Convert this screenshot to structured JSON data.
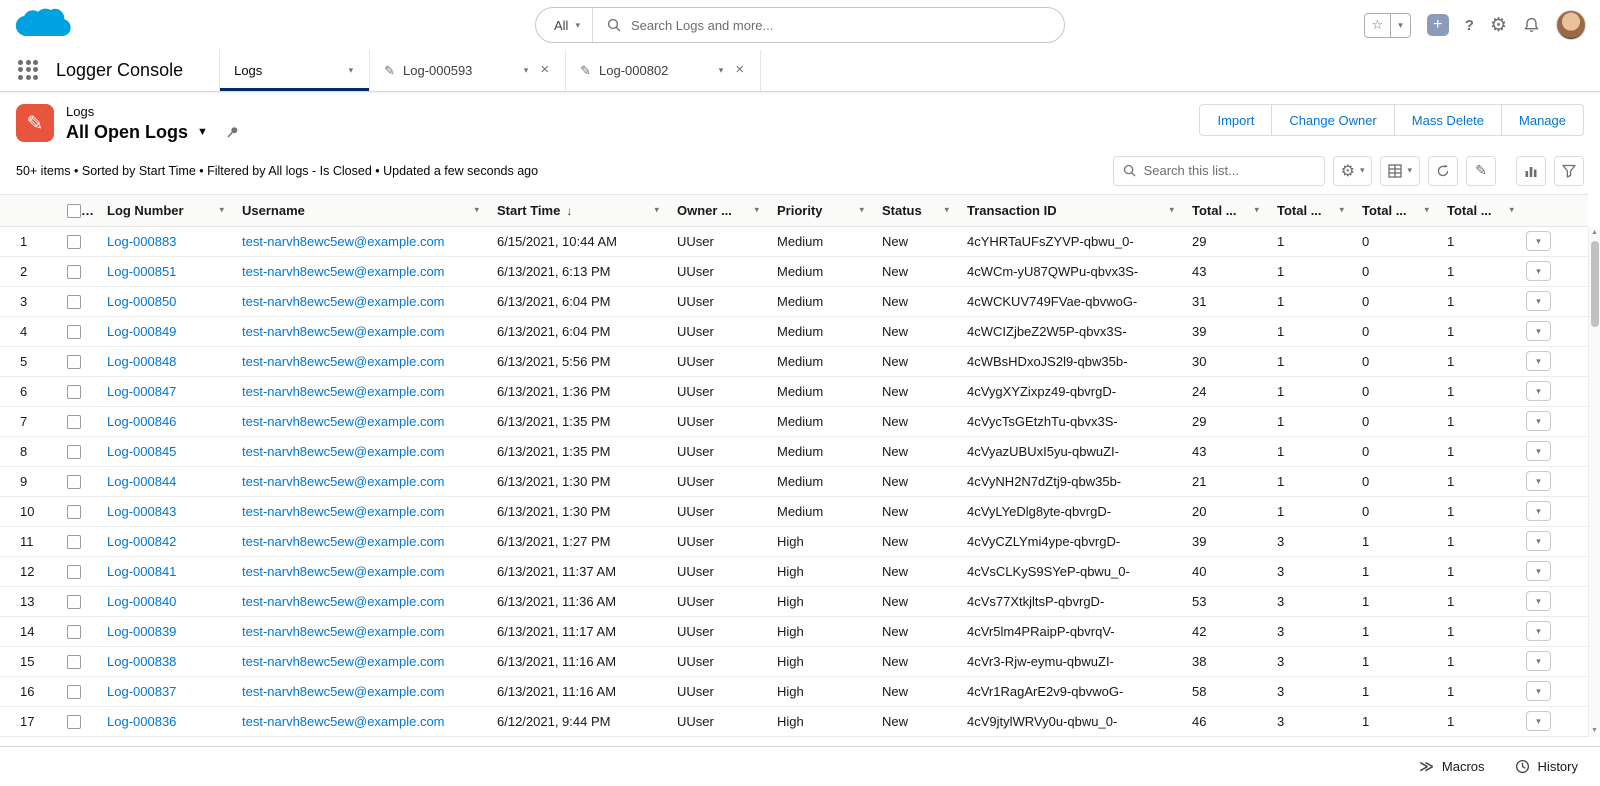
{
  "colors": {
    "brand_cloud": "#00a1e0",
    "link": "#0176d3",
    "active_tab_underline": "#032d60",
    "record_icon_bg": "#e8553d"
  },
  "global_header": {
    "search_scope": "All",
    "search_placeholder": "Search Logs and more..."
  },
  "nav": {
    "app_name": "Logger Console",
    "tabs": [
      {
        "label": "Logs",
        "active": true,
        "record": false,
        "closable": false
      },
      {
        "label": "Log-000593",
        "active": false,
        "record": true,
        "closable": true
      },
      {
        "label": "Log-000802",
        "active": false,
        "record": true,
        "closable": true
      }
    ]
  },
  "list_view": {
    "object_label": "Logs",
    "title": "All Open Logs",
    "actions": [
      "Import",
      "Change Owner",
      "Mass Delete",
      "Manage"
    ],
    "summary": "50+ items • Sorted by Start Time • Filtered by All logs - Is Closed • Updated a few seconds ago",
    "search_placeholder": "Search this list..."
  },
  "table": {
    "columns": [
      {
        "label": "Log Number"
      },
      {
        "label": "Username"
      },
      {
        "label": "Start Time",
        "sorted": "desc"
      },
      {
        "label": "Owner ..."
      },
      {
        "label": "Priority"
      },
      {
        "label": "Status"
      },
      {
        "label": "Transaction ID"
      },
      {
        "label": "Total ..."
      },
      {
        "label": "Total ..."
      },
      {
        "label": "Total ..."
      },
      {
        "label": "Total ..."
      }
    ],
    "rows": [
      [
        "1",
        "Log-000883",
        "test-narvh8ewc5ew@example.com",
        "6/15/2021, 10:44 AM",
        "UUser",
        "Medium",
        "New",
        "4cYHRTaUFsZYVP-qbwu_0-",
        "29",
        "1",
        "0",
        "1"
      ],
      [
        "2",
        "Log-000851",
        "test-narvh8ewc5ew@example.com",
        "6/13/2021, 6:13 PM",
        "UUser",
        "Medium",
        "New",
        "4cWCm-yU87QWPu-qbvx3S-",
        "43",
        "1",
        "0",
        "1"
      ],
      [
        "3",
        "Log-000850",
        "test-narvh8ewc5ew@example.com",
        "6/13/2021, 6:04 PM",
        "UUser",
        "Medium",
        "New",
        "4cWCKUV749FVae-qbvwoG-",
        "31",
        "1",
        "0",
        "1"
      ],
      [
        "4",
        "Log-000849",
        "test-narvh8ewc5ew@example.com",
        "6/13/2021, 6:04 PM",
        "UUser",
        "Medium",
        "New",
        "4cWCIZjbeZ2W5P-qbvx3S-",
        "39",
        "1",
        "0",
        "1"
      ],
      [
        "5",
        "Log-000848",
        "test-narvh8ewc5ew@example.com",
        "6/13/2021, 5:56 PM",
        "UUser",
        "Medium",
        "New",
        "4cWBsHDxoJS2l9-qbw35b-",
        "30",
        "1",
        "0",
        "1"
      ],
      [
        "6",
        "Log-000847",
        "test-narvh8ewc5ew@example.com",
        "6/13/2021, 1:36 PM",
        "UUser",
        "Medium",
        "New",
        "4cVygXYZixpz49-qbvrgD-",
        "24",
        "1",
        "0",
        "1"
      ],
      [
        "7",
        "Log-000846",
        "test-narvh8ewc5ew@example.com",
        "6/13/2021, 1:35 PM",
        "UUser",
        "Medium",
        "New",
        "4cVycTsGEtzhTu-qbvx3S-",
        "29",
        "1",
        "0",
        "1"
      ],
      [
        "8",
        "Log-000845",
        "test-narvh8ewc5ew@example.com",
        "6/13/2021, 1:35 PM",
        "UUser",
        "Medium",
        "New",
        "4cVyazUBUxI5yu-qbwuZI-",
        "43",
        "1",
        "0",
        "1"
      ],
      [
        "9",
        "Log-000844",
        "test-narvh8ewc5ew@example.com",
        "6/13/2021, 1:30 PM",
        "UUser",
        "Medium",
        "New",
        "4cVyNH2N7dZtj9-qbw35b-",
        "21",
        "1",
        "0",
        "1"
      ],
      [
        "10",
        "Log-000843",
        "test-narvh8ewc5ew@example.com",
        "6/13/2021, 1:30 PM",
        "UUser",
        "Medium",
        "New",
        "4cVyLYeDlg8yte-qbvrgD-",
        "20",
        "1",
        "0",
        "1"
      ],
      [
        "11",
        "Log-000842",
        "test-narvh8ewc5ew@example.com",
        "6/13/2021, 1:27 PM",
        "UUser",
        "High",
        "New",
        "4cVyCZLYmi4ype-qbvrgD-",
        "39",
        "3",
        "1",
        "1"
      ],
      [
        "12",
        "Log-000841",
        "test-narvh8ewc5ew@example.com",
        "6/13/2021, 11:37 AM",
        "UUser",
        "High",
        "New",
        "4cVsCLKyS9SYeP-qbwu_0-",
        "40",
        "3",
        "1",
        "1"
      ],
      [
        "13",
        "Log-000840",
        "test-narvh8ewc5ew@example.com",
        "6/13/2021, 11:36 AM",
        "UUser",
        "High",
        "New",
        "4cVs77XtkjltsP-qbvrgD-",
        "53",
        "3",
        "1",
        "1"
      ],
      [
        "14",
        "Log-000839",
        "test-narvh8ewc5ew@example.com",
        "6/13/2021, 11:17 AM",
        "UUser",
        "High",
        "New",
        "4cVr5lm4PRaipP-qbvrqV-",
        "42",
        "3",
        "1",
        "1"
      ],
      [
        "15",
        "Log-000838",
        "test-narvh8ewc5ew@example.com",
        "6/13/2021, 11:16 AM",
        "UUser",
        "High",
        "New",
        "4cVr3-Rjw-eymu-qbwuZI-",
        "38",
        "3",
        "1",
        "1"
      ],
      [
        "16",
        "Log-000837",
        "test-narvh8ewc5ew@example.com",
        "6/13/2021, 11:16 AM",
        "UUser",
        "High",
        "New",
        "4cVr1RagArE2v9-qbvwoG-",
        "58",
        "3",
        "1",
        "1"
      ],
      [
        "17",
        "Log-000836",
        "test-narvh8ewc5ew@example.com",
        "6/12/2021, 9:44 PM",
        "UUser",
        "High",
        "New",
        "4cV9jtylWRVy0u-qbwu_0-",
        "46",
        "3",
        "1",
        "1"
      ]
    ]
  },
  "utility_bar": {
    "macros_label": "Macros",
    "history_label": "History"
  }
}
